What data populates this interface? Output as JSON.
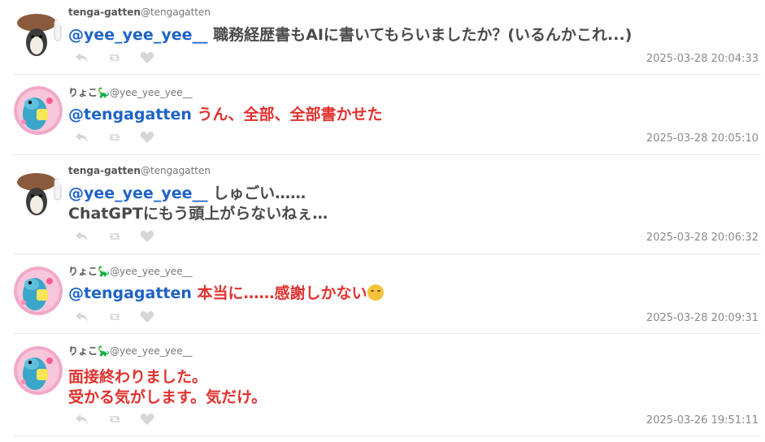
{
  "posts": [
    {
      "name": "tenga-gatten",
      "handle": "@tengagatten",
      "mention": "@yee_yee_yee__",
      "lines": [
        "職務経歴書もAIに書いてもらいましたか？(いるんかこれ...)"
      ],
      "color": "gray",
      "timestamp": "2025-03-28 20:04:33",
      "avatar": "tenga"
    },
    {
      "name": "りょこ",
      "name_emoji": "🦕",
      "handle": "@yee_yee_yee__",
      "mention": "@tengagatten",
      "lines": [
        "うん、全部、全部書かせた"
      ],
      "color": "red",
      "timestamp": "2025-03-28 20:05:10",
      "avatar": "ryoko"
    },
    {
      "name": "tenga-gatten",
      "handle": "@tengagatten",
      "mention": "@yee_yee_yee__",
      "lines": [
        "しゅごい……",
        "ChatGPTにもう頭上がらないねぇ…"
      ],
      "color": "gray",
      "timestamp": "2025-03-28 20:06:32",
      "avatar": "tenga"
    },
    {
      "name": "りょこ",
      "name_emoji": "🦕",
      "handle": "@yee_yee_yee__",
      "mention": "@tengagatten",
      "lines": [
        "本当に……感謝しかない"
      ],
      "trailing_emoji": "smiling-face-with-tear",
      "color": "red",
      "timestamp": "2025-03-28 20:09:31",
      "avatar": "ryoko"
    },
    {
      "name": "りょこ",
      "name_emoji": "🦕",
      "handle": "@yee_yee_yee__",
      "mention": "",
      "lines": [
        "面接終わりました。",
        "受かる気がします。気だけ。"
      ],
      "color": "red",
      "timestamp": "2025-03-26 19:51:11",
      "avatar": "ryoko"
    }
  ],
  "colors": {
    "mention": "#1e63c6",
    "gray_text": "#4a4a4a",
    "red_text": "#e0322e",
    "timestamp": "#8a8a8a",
    "action_icon": "#d0d0d0"
  },
  "icons": [
    "reply-icon",
    "repost-icon",
    "like-icon"
  ]
}
